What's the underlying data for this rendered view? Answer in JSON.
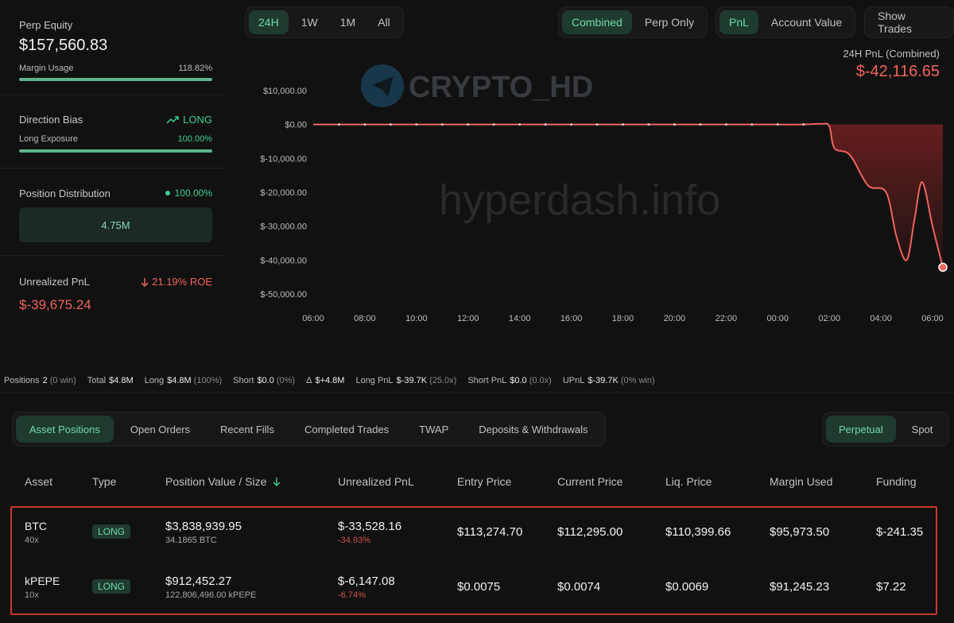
{
  "left": {
    "perp_equity_label": "Perp Equity",
    "perp_equity_value": "$157,560.83",
    "margin_usage_label": "Margin Usage",
    "margin_usage_value": "118.82%",
    "margin_usage_fill": 1.0,
    "direction_bias_label": "Direction Bias",
    "direction_bias_value": "LONG",
    "long_exposure_label": "Long Exposure",
    "long_exposure_value": "100.00%",
    "long_exposure_fill": 1.0,
    "position_distribution_label": "Position Distribution",
    "position_distribution_value": "100.00%",
    "position_distribution_amount": "4.75M",
    "unrealized_pnl_label": "Unrealized PnL",
    "unrealized_roe": "21.19% ROE",
    "unrealized_pnl_value": "$-39,675.24"
  },
  "chart_controls": {
    "ranges": [
      "24H",
      "1W",
      "1M",
      "All"
    ],
    "active_range": "24H",
    "modes": [
      "Combined",
      "Perp Only"
    ],
    "active_mode": "Combined",
    "metrics": [
      "PnL",
      "Account Value"
    ],
    "active_metric": "PnL",
    "show_trades": "Show Trades"
  },
  "chart_header": {
    "label": "24H PnL (Combined)",
    "value": "$-42,116.65"
  },
  "watermarks": {
    "brand": "CRYPTO_HD",
    "site": "hyperdash.info"
  },
  "chart_data": {
    "type": "area",
    "title": "24H PnL (Combined)",
    "x_ticks": [
      "06:00",
      "08:00",
      "10:00",
      "12:00",
      "14:00",
      "16:00",
      "18:00",
      "20:00",
      "22:00",
      "00:00",
      "02:00",
      "04:00",
      "06:00"
    ],
    "y_ticks": [
      "$10,000.00",
      "$0.00",
      "$-10,000.00",
      "$-20,000.00",
      "$-30,000.00",
      "$-40,000.00",
      "$-50,000.00"
    ],
    "ylim": [
      -50000,
      10000
    ],
    "x_range_hours": [
      0,
      24.4
    ],
    "series": [
      {
        "x": [
          0,
          1,
          2,
          3,
          4,
          5,
          6,
          7,
          8,
          9,
          10,
          11,
          12,
          13,
          14,
          15,
          16,
          17,
          18,
          19,
          19.7,
          20.0,
          20.2,
          20.8,
          21.5,
          22.2,
          22.6,
          23.0,
          23.3,
          23.6,
          24.0,
          24.4
        ],
        "y": [
          0,
          0,
          0,
          0,
          0,
          0,
          0,
          0,
          0,
          0,
          0,
          0,
          0,
          0,
          0,
          0,
          0,
          0,
          0,
          0,
          200,
          -500,
          -7000,
          -9000,
          -18000,
          -20000,
          -33000,
          -40000,
          -28000,
          -17000,
          -30000,
          -42116.65
        ]
      }
    ],
    "grid": false,
    "colors": {
      "line": "#f0645c",
      "fill": "#6a1f1f"
    }
  },
  "summary": {
    "positions_label": "Positions",
    "positions_value": "2",
    "positions_note": "(0 win)",
    "total_label": "Total",
    "total_value": "$4.8M",
    "long_label": "Long",
    "long_value": "$4.8M",
    "long_note": "(100%)",
    "short_label": "Short",
    "short_value": "$0.0",
    "short_note": "(0%)",
    "delta_label": "Δ",
    "delta_value": "$+4.8M",
    "longpnl_label": "Long PnL",
    "longpnl_value": "$-39.7K",
    "longpnl_note": "(25.0x)",
    "shortpnl_label": "Short PnL",
    "shortpnl_value": "$0.0",
    "shortpnl_note": "(0.0x)",
    "upnl_label": "UPnL",
    "upnl_value": "$-39.7K",
    "upnl_note": "(0% win)"
  },
  "tabs": [
    "Asset Positions",
    "Open Orders",
    "Recent Fills",
    "Completed Trades",
    "TWAP",
    "Deposits & Withdrawals"
  ],
  "market_types": [
    "Perpetual",
    "Spot"
  ],
  "table": {
    "headers": [
      "Asset",
      "Type",
      "Position Value / Size",
      "Unrealized PnL",
      "Entry Price",
      "Current Price",
      "Liq. Price",
      "Margin Used",
      "Funding"
    ],
    "rows": [
      {
        "asset": "BTC",
        "leverage": "40x",
        "type": "LONG",
        "value": "$3,838,939.95",
        "size": "34.1865 BTC",
        "upnl": "$-33,528.16",
        "upnl_pct": "-34.93%",
        "entry": "$113,274.70",
        "current": "$112,295.00",
        "liq": "$110,399.66",
        "margin": "$95,973.50",
        "funding": "$-241.35"
      },
      {
        "asset": "kPEPE",
        "leverage": "10x",
        "type": "LONG",
        "value": "$912,452.27",
        "size": "122,806,496.00 kPEPE",
        "upnl": "$-6,147.08",
        "upnl_pct": "-6.74%",
        "entry": "$0.0075",
        "current": "$0.0074",
        "liq": "$0.0069",
        "margin": "$91,245.23",
        "funding": "$7.22"
      }
    ]
  }
}
